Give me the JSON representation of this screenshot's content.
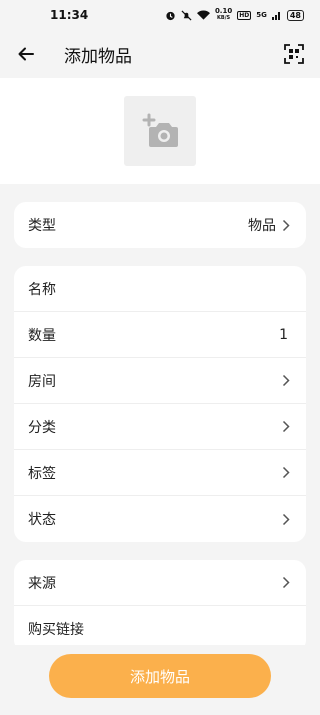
{
  "status_bar": {
    "time": "11:34",
    "net_speed_value": "0.10",
    "net_speed_unit": "KB/S",
    "hd_label": "HD",
    "signal_label": "5G",
    "battery": "48"
  },
  "header": {
    "title": "添加物品"
  },
  "type_card": {
    "label": "类型",
    "value": "物品"
  },
  "details_card": {
    "rows": [
      {
        "label": "名称",
        "value": ""
      },
      {
        "label": "数量",
        "value": "1"
      },
      {
        "label": "房间"
      },
      {
        "label": "分类"
      },
      {
        "label": "标签"
      },
      {
        "label": "状态"
      }
    ]
  },
  "source_card": {
    "rows": [
      {
        "label": "来源"
      },
      {
        "label": "购买链接"
      }
    ]
  },
  "submit_label": "添加物品",
  "colors": {
    "accent": "#fbb04c",
    "background": "#f4f4f4",
    "card": "#ffffff"
  },
  "icons": {
    "back": "arrow-left-icon",
    "scan": "qr-scan-icon",
    "photo": "add-photo-icon",
    "chevron": "chevron-right-icon"
  }
}
